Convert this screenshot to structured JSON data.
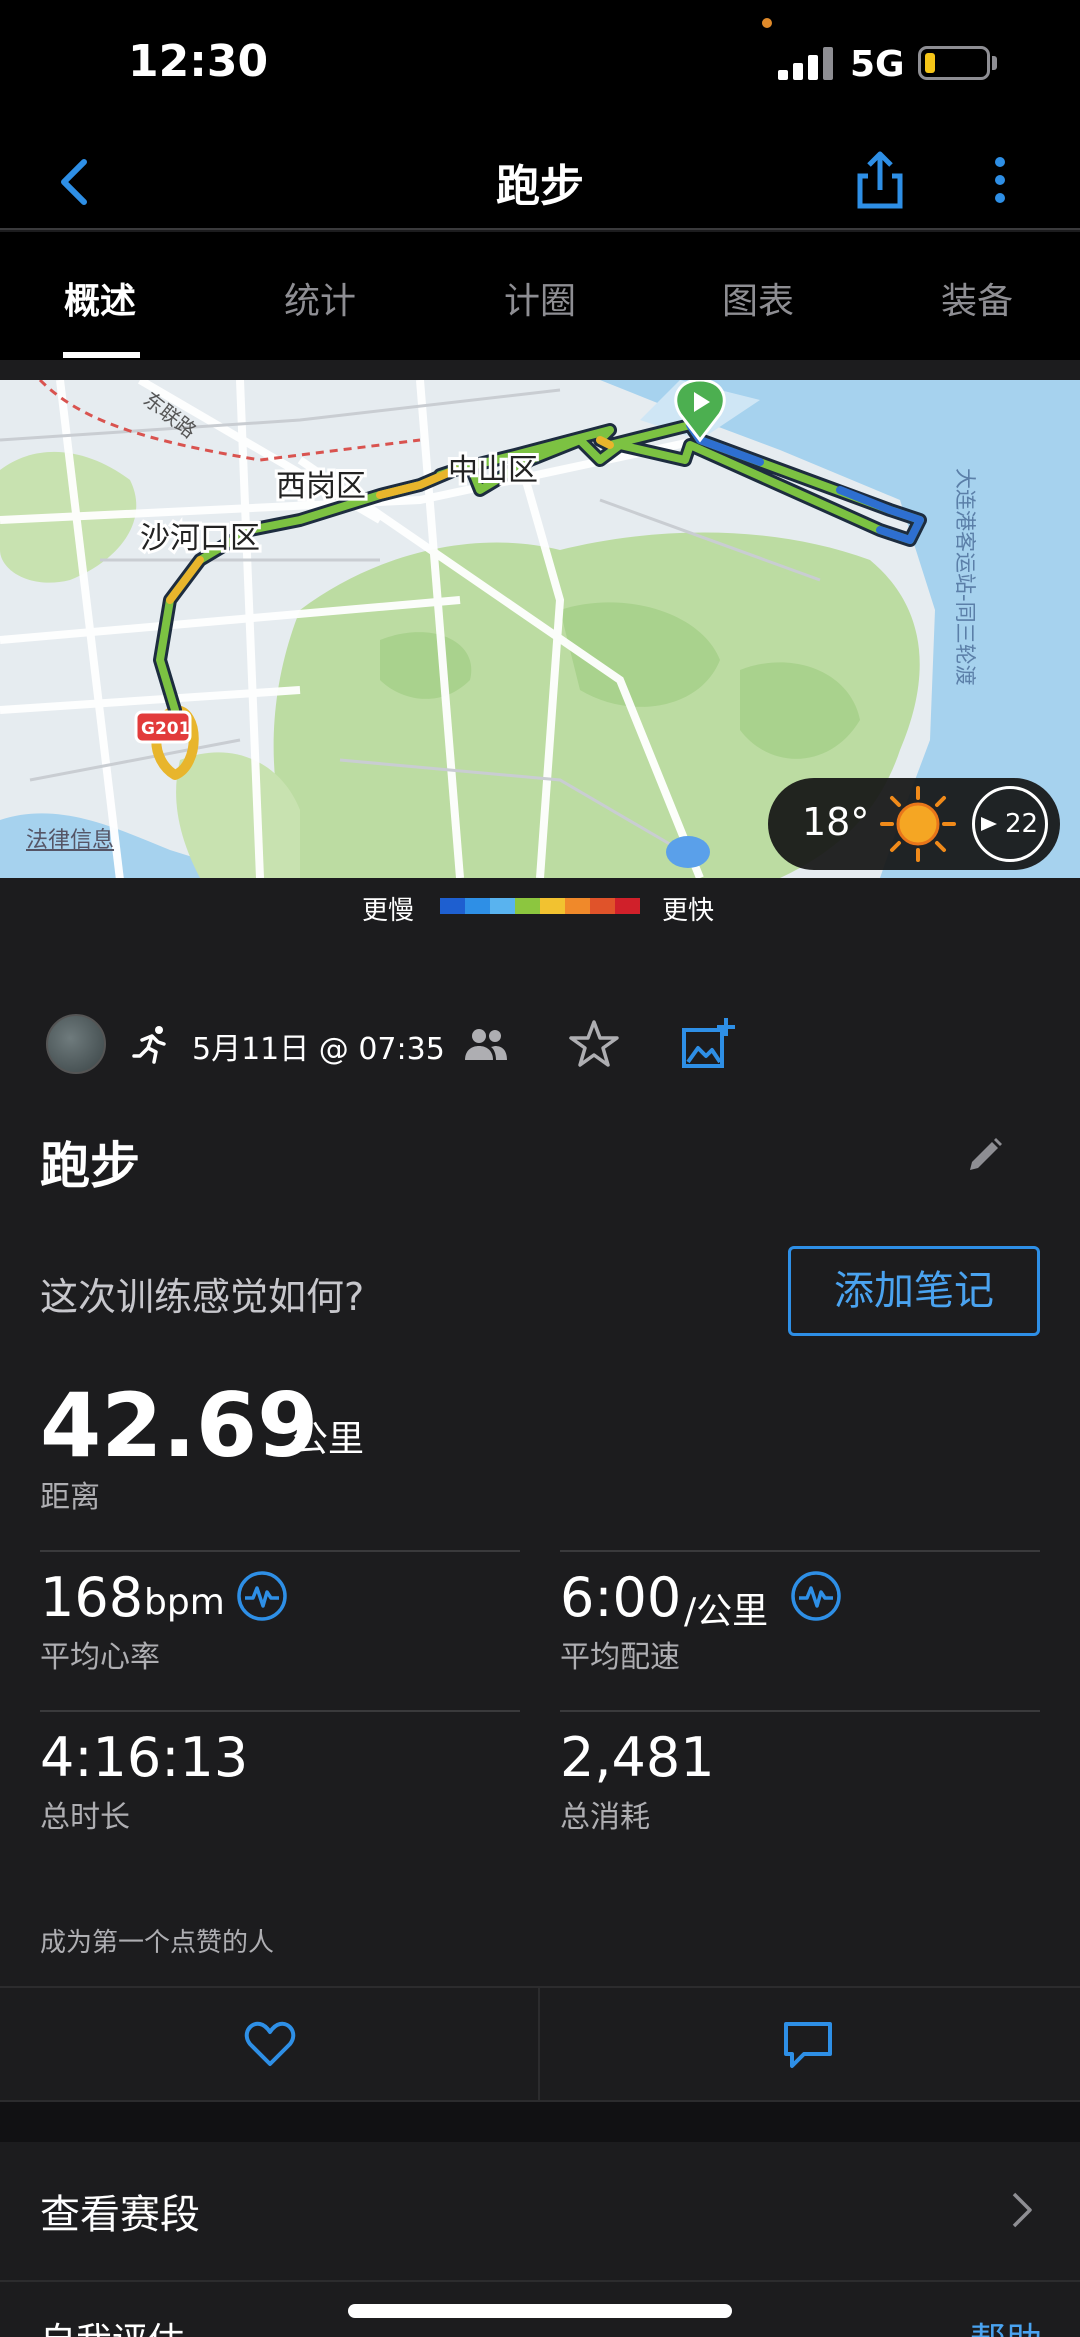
{
  "status_bar": {
    "time": "12:30",
    "network": "5G",
    "battery_level": 0.15,
    "battery_color": "#f5c518"
  },
  "nav": {
    "title": "跑步",
    "back_icon": "chevron-left-icon",
    "share_icon": "share-icon",
    "more_icon": "more-vertical-icon",
    "accent": "#2e8fe6"
  },
  "tabs": [
    {
      "label": "概述",
      "active": true
    },
    {
      "label": "统计",
      "active": false
    },
    {
      "label": "计圈",
      "active": false
    },
    {
      "label": "图表",
      "active": false
    },
    {
      "label": "装备",
      "active": false
    }
  ],
  "map": {
    "labels": {
      "xigang": "西岗区",
      "zhongshan": "中山区",
      "shahekou": "沙河口区",
      "road_dongfeng": "东联路",
      "highway": "G201",
      "ferry": "大连港客运站-同三轮渡"
    },
    "legal": "法律信息",
    "weather": {
      "temperature": "18°",
      "condition_icon": "sun-icon",
      "wind": "22"
    }
  },
  "speed_legend": {
    "slow": "更慢",
    "fast": "更快",
    "colors": [
      "#1e5fd0",
      "#2e8fe6",
      "#59b3ef",
      "#8cc63f",
      "#f2c230",
      "#f0892a",
      "#e0532a",
      "#d0202a"
    ]
  },
  "activity": {
    "date": "5月11日 @ 07:35",
    "title": "跑步",
    "feel_question": "这次训练感觉如何?",
    "add_note_label": "添加笔记",
    "distance": {
      "value": "42.69",
      "unit": "公里",
      "label": "距离"
    },
    "stats": {
      "heart_rate": {
        "value": "168",
        "unit": "bpm",
        "label": "平均心率"
      },
      "pace": {
        "value": "6:00",
        "unit": "/公里",
        "label": "平均配速"
      },
      "duration": {
        "value": "4:16:13",
        "label": "总时长"
      },
      "calories": {
        "value": "2,481",
        "label": "总消耗"
      }
    },
    "like_prompt": "成为第一个点赞的人"
  },
  "segments": {
    "label": "查看赛段"
  },
  "next_section": {
    "label": "自我评估",
    "help": "帮助"
  }
}
